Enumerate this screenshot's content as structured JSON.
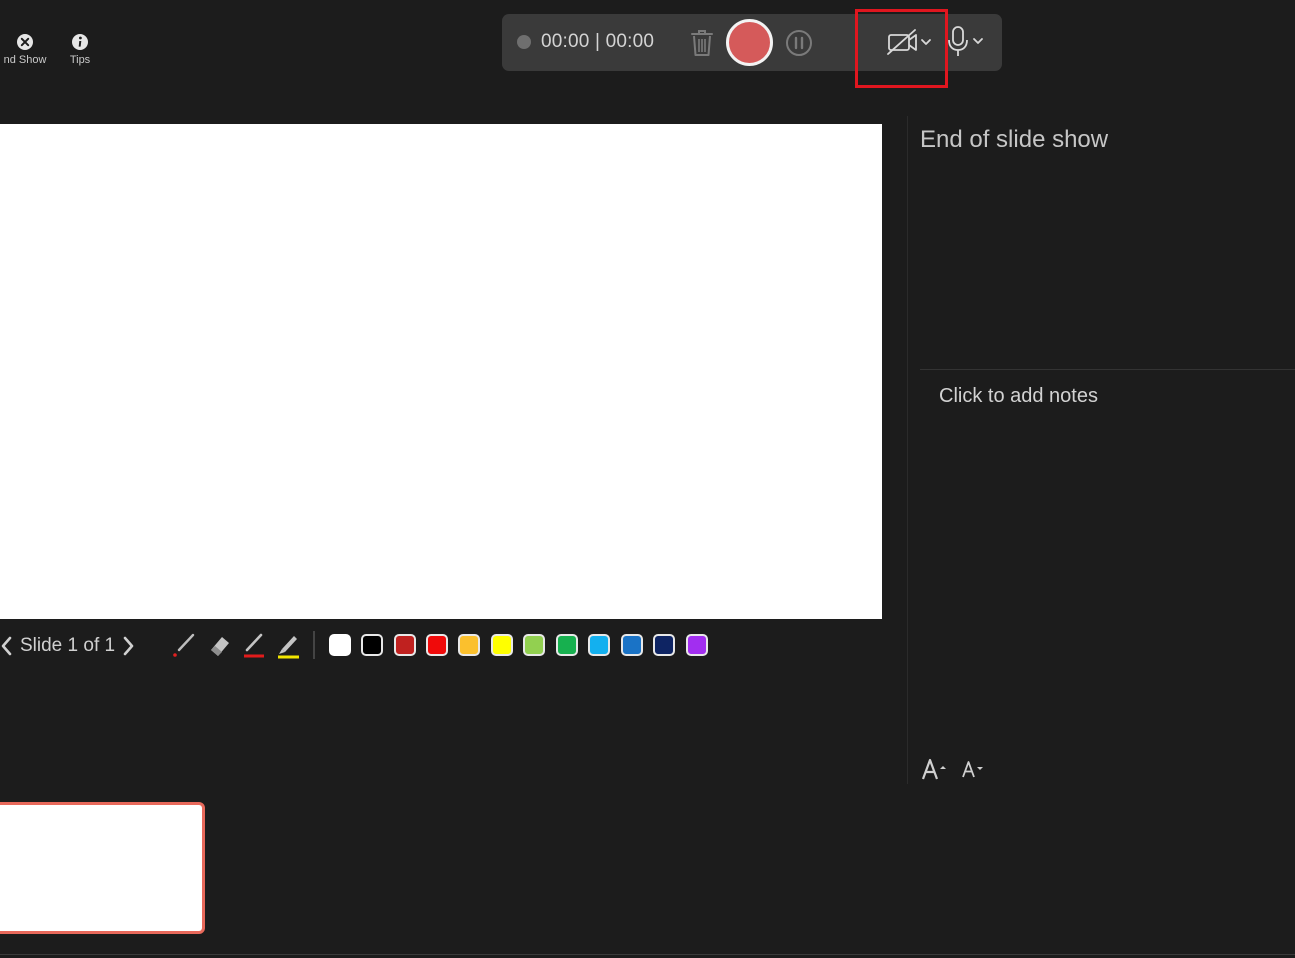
{
  "top_left": {
    "end_show_label": "nd Show",
    "tips_label": "Tips"
  },
  "recording_toolbar": {
    "timer": "00:00 | 00:00",
    "record_color": "#d55a5a",
    "camera_icon": "camera-off-icon",
    "mic_icon": "microphone-icon"
  },
  "slide_nav": {
    "counter": "Slide 1 of 1"
  },
  "ink_colors": [
    "#ffffff",
    "#000000",
    "#c0211f",
    "#f00a0a",
    "#fbc02d",
    "#ffff00",
    "#92d050",
    "#17b04f",
    "#13b0ef",
    "#1a73c6",
    "#0e2463",
    "#a22ef0"
  ],
  "notes_panel": {
    "next_slide_text": "End of slide show",
    "notes_placeholder": "Click to add notes"
  },
  "highlight_color": "#e0161f"
}
